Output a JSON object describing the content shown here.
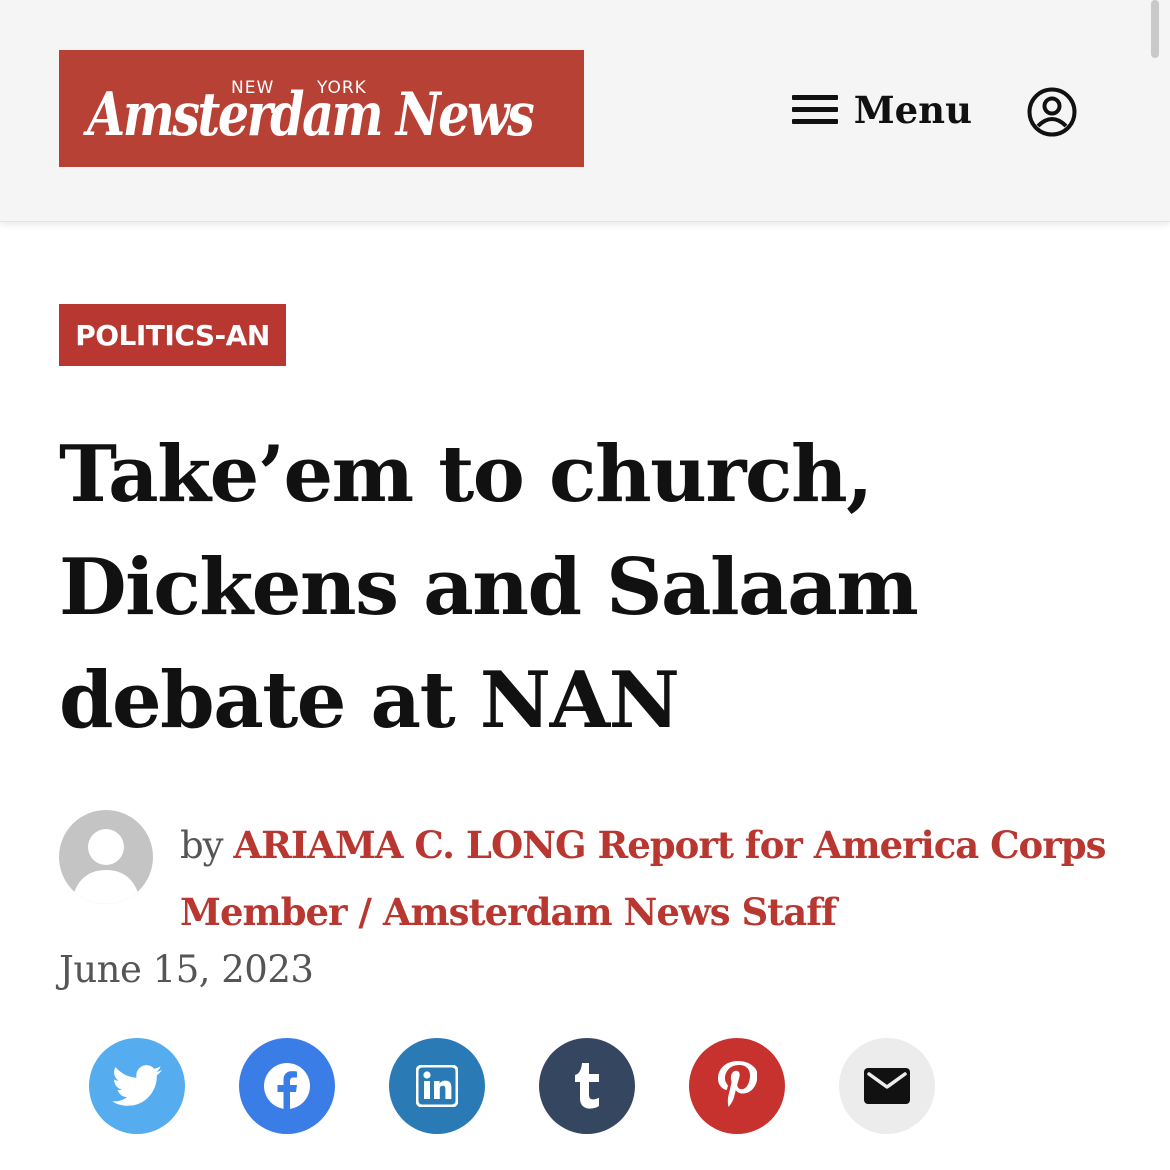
{
  "header": {
    "logo": {
      "small_left": "NEW",
      "small_right": "YORK",
      "name": "Amsterdam News"
    },
    "menu_label": "Menu"
  },
  "article": {
    "category": "POLITICS-AN",
    "headline": "Take’em to church, Dickens and Salaam debate at NAN",
    "byline_prefix": "by",
    "author": "ARIAMA C. LONG Report for America Corps Member / Amsterdam News Staff",
    "date": "June 15, 2023"
  },
  "share": [
    {
      "name": "twitter",
      "icon": "twitter-bird-icon",
      "color": "#55acee"
    },
    {
      "name": "facebook",
      "icon": "facebook-icon",
      "color": "#3b7de7"
    },
    {
      "name": "linkedin",
      "icon": "linkedin-icon",
      "color": "#2a7ab6"
    },
    {
      "name": "tumblr",
      "icon": "tumblr-icon",
      "color": "#344660"
    },
    {
      "name": "pinterest",
      "icon": "pinterest-icon",
      "color": "#c7322f"
    },
    {
      "name": "email",
      "icon": "envelope-icon",
      "color": "#ececec"
    }
  ],
  "colors": {
    "brand_red": "#b84136",
    "accent_red": "#b83731",
    "header_bg": "#f5f5f5"
  }
}
